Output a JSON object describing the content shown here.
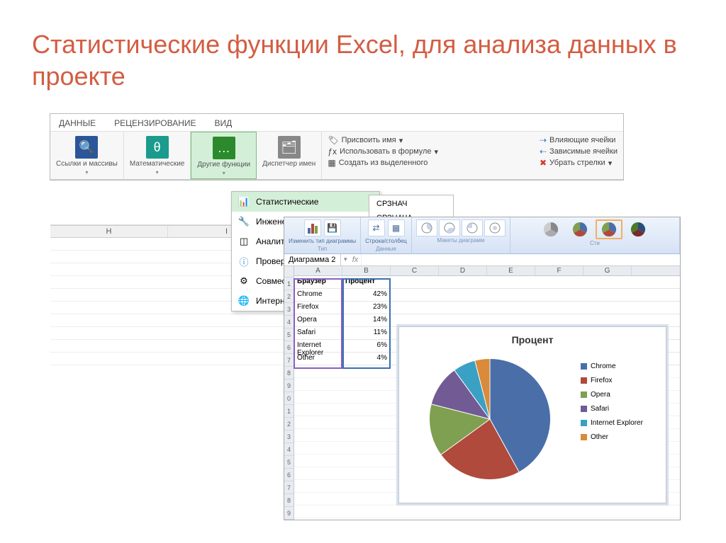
{
  "slide": {
    "title": "Статистические функции Excel, для анализа данных в проекте"
  },
  "ribbon": {
    "tabs": [
      "ДАННЫЕ",
      "РЕЦЕНЗИРОВАНИЕ",
      "ВИД"
    ],
    "groups": {
      "g0": {
        "label": "Ссылки и массивы"
      },
      "g1": {
        "label": "Математические"
      },
      "g2": {
        "label": "Другие функции"
      },
      "g3": {
        "label": "Диспетчер имен"
      }
    },
    "names": {
      "assign": "Присвоить имя",
      "use": "Использовать в формуле",
      "create": "Создать из выделенного"
    },
    "audit": {
      "trace": "Влияющие ячейки",
      "deps": "Зависимые ячейки",
      "remove": "Убрать стрелки"
    }
  },
  "dropdown": {
    "items": [
      {
        "icon": "📊",
        "label": "Статистические"
      },
      {
        "icon": "🔧",
        "label": "Инженерные"
      },
      {
        "icon": "📐",
        "label": "Аналитические"
      },
      {
        "icon": "ℹ",
        "label": "Проверка свойств и"
      },
      {
        "icon": "⚙",
        "label": "Совместимость"
      },
      {
        "icon": "🌐",
        "label": "Интернет"
      }
    ]
  },
  "submenu": {
    "i0": "СРЗНАЧ",
    "i1": "СРЗНАЧА"
  },
  "grid_cols": [
    "H",
    "I"
  ],
  "excel2": {
    "chart_ribbon": {
      "type": "Тип",
      "type_btn1": "Изменить тип диаграммы",
      "type_btn2": "Сохранить как шаблон",
      "data": "Данные",
      "data_btn1": "Строка/столбец",
      "data_btn2": "Выбрать данные",
      "layouts": "Макеты диаграмм",
      "styles": "Сти"
    },
    "namebox": "Диаграмма 2",
    "columns": [
      "A",
      "B",
      "C",
      "D",
      "E",
      "F",
      "G"
    ],
    "table": {
      "header": [
        "Браузер",
        "Процент"
      ],
      "rows": [
        [
          "Chrome",
          "42%"
        ],
        [
          "Firefox",
          "23%"
        ],
        [
          "Opera",
          "14%"
        ],
        [
          "Safari",
          "11%"
        ],
        [
          "Internet Explorer",
          "6%"
        ],
        [
          "Other",
          "4%"
        ]
      ]
    }
  },
  "chart_data": {
    "type": "pie",
    "title": "Процент",
    "categories": [
      "Chrome",
      "Firefox",
      "Opera",
      "Safari",
      "Internet Explorer",
      "Other"
    ],
    "values": [
      42,
      23,
      14,
      11,
      6,
      4
    ],
    "colors": [
      "#4a6fa8",
      "#b04a3c",
      "#7ea050",
      "#725b94",
      "#3aa0c4",
      "#d98a3a"
    ]
  }
}
